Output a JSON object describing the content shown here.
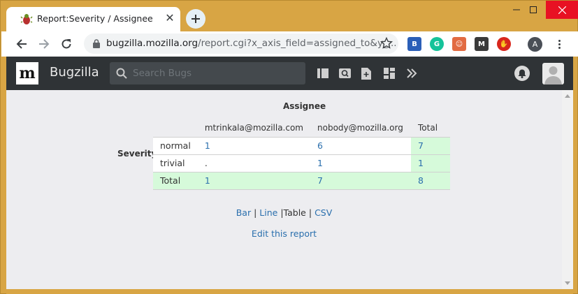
{
  "browser": {
    "tab": {
      "title": "Report:Severity / Assignee",
      "close": "✕"
    },
    "new_tab_label": "+",
    "window_controls": {
      "minimize": "—",
      "maximize": "☐",
      "close": "✕"
    },
    "address": {
      "host": "bugzilla.mozilla.org",
      "path": "/report.cgi?x_axis_field=assigned_to&y_..."
    },
    "profile_initial": "A",
    "frame_color": "#d8a544"
  },
  "bugzilla": {
    "logo_letter": "m",
    "title": "Bugzilla",
    "search_placeholder": "Search Bugs",
    "header_icons": [
      "sidebar-icon",
      "search-saved-icon",
      "new-bug-icon",
      "dashboard-icon",
      "more-icon"
    ]
  },
  "report": {
    "x_axis_title": "Assignee",
    "y_axis_title": "Severity",
    "columns": [
      "",
      "mtrinkala@mozilla.com",
      "nobody@mozilla.org",
      "Total"
    ],
    "rows": [
      {
        "label": "normal",
        "cells": [
          "1",
          "6",
          "7"
        ]
      },
      {
        "label": "trivial",
        "cells": [
          ".",
          "1",
          "1"
        ]
      }
    ],
    "total_row": {
      "label": "Total",
      "cells": [
        "1",
        "7",
        "8"
      ]
    },
    "formats": {
      "bar": "Bar",
      "sep1": "|",
      "line": "Line",
      "sep2": "|",
      "table": "Table",
      "sep3": "|",
      "csv": "CSV"
    },
    "edit_link": "Edit this report"
  },
  "colors": {
    "link": "#2a6fad",
    "total_highlight": "#d6fada",
    "header_bg": "#2f3336"
  }
}
